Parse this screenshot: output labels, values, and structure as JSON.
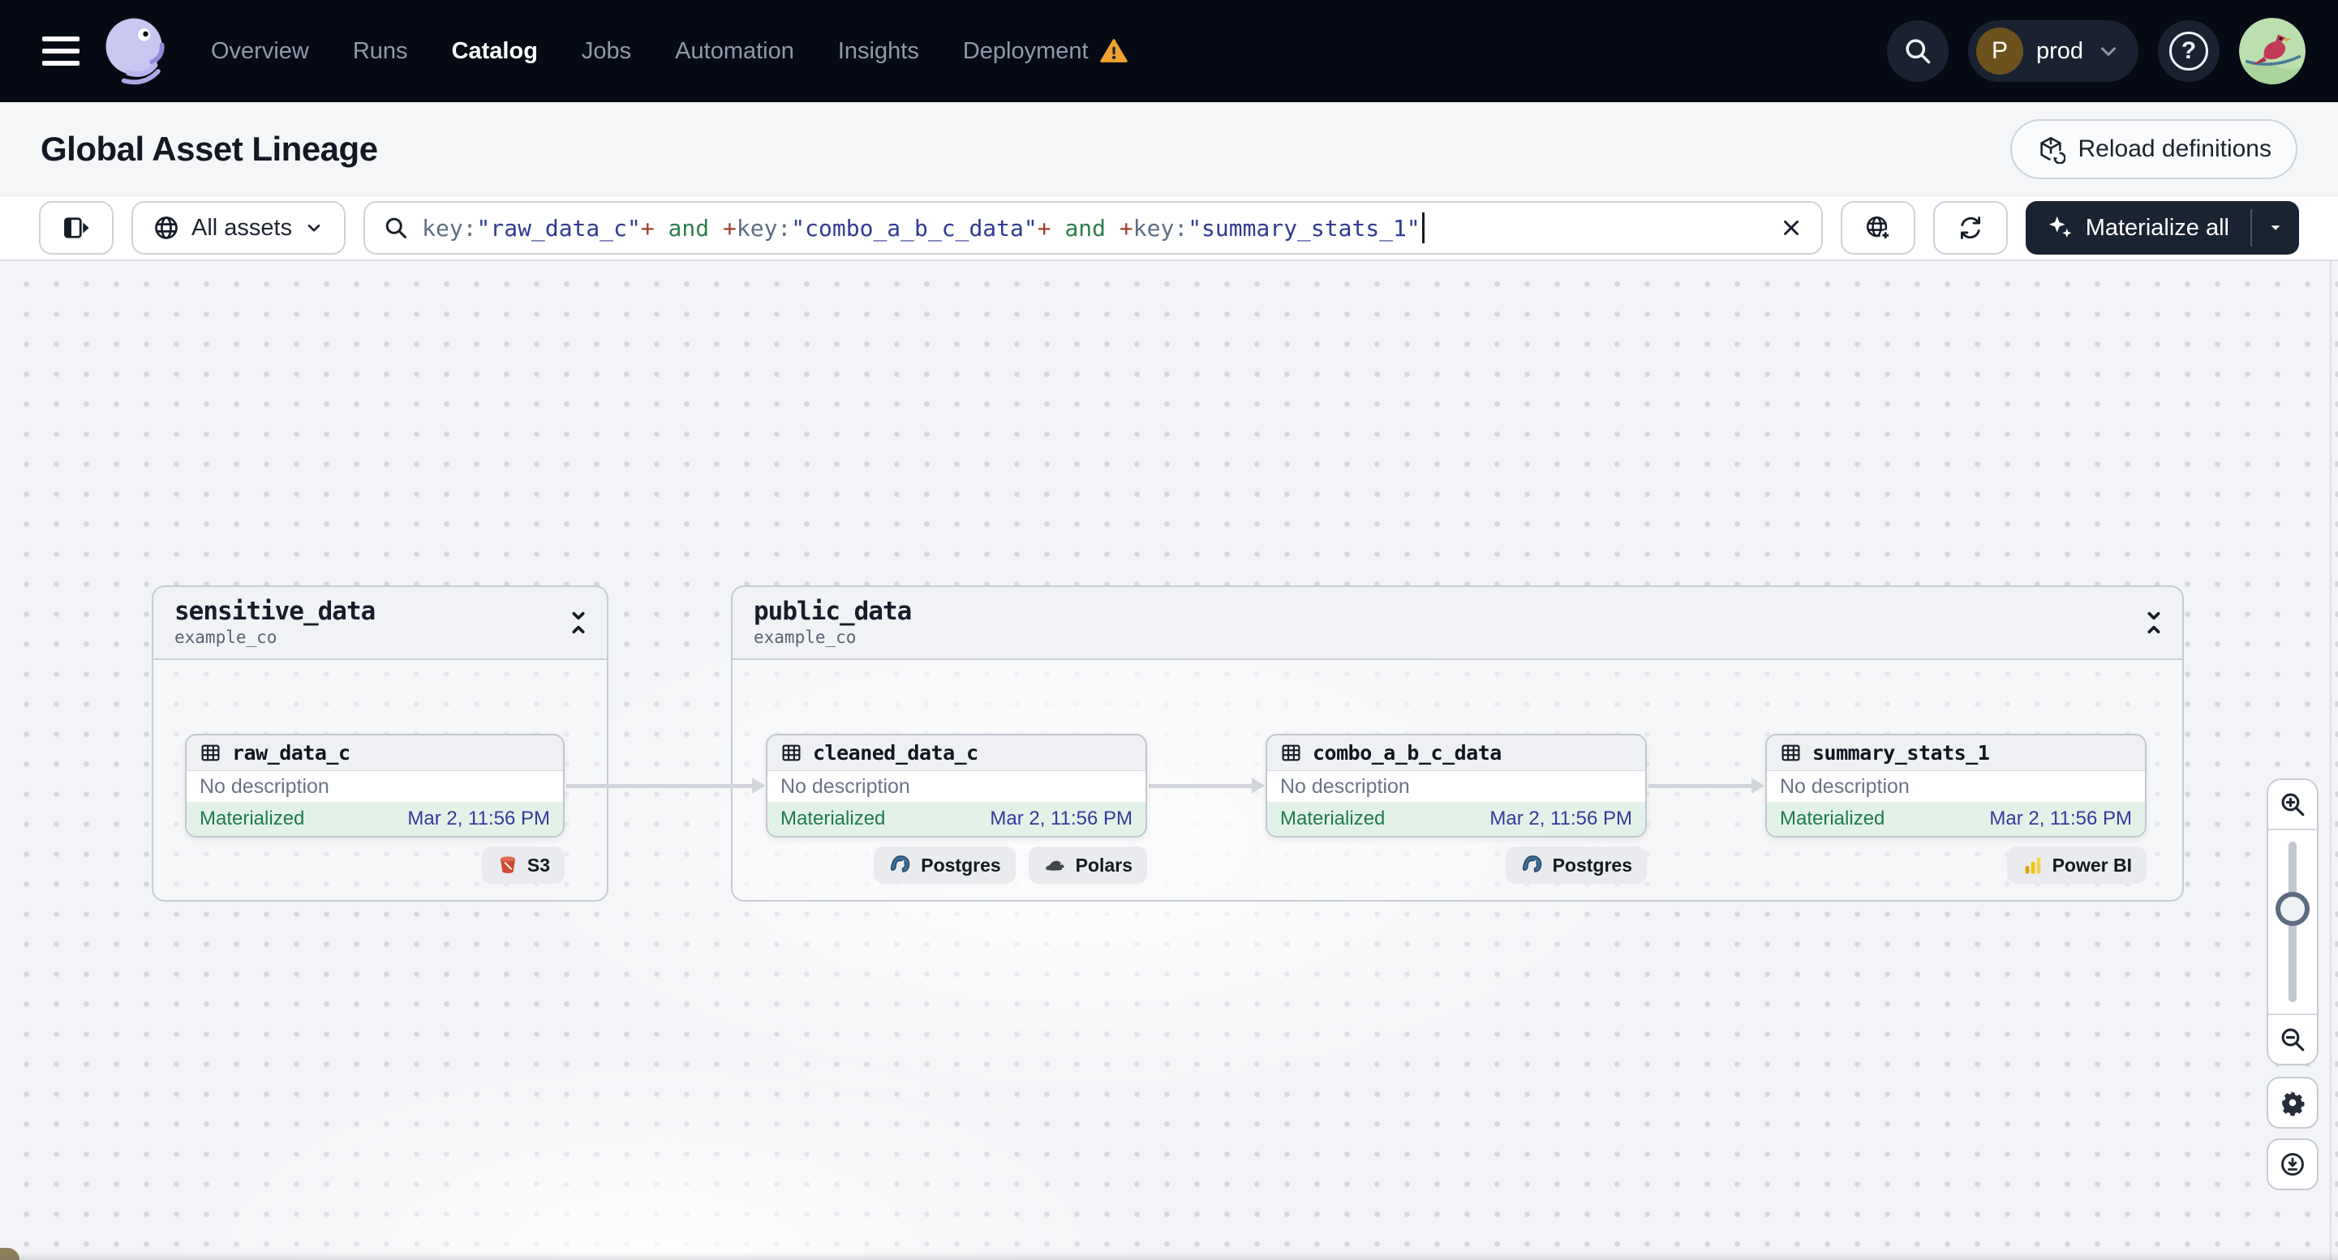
{
  "colors": {
    "nav_background": "#060a14",
    "accent_dark": "#1a2332",
    "warning_orange": "#f0a232",
    "status_green_text": "#1e7b4b",
    "status_green_bg": "#e3f2e9",
    "timestamp_indigo": "#343a9a",
    "query_key": "#5e6e82",
    "query_string": "#303a93",
    "query_plus": "#9e3e2a",
    "query_and": "#2f7d4c",
    "edge_gray": "#d2d5db"
  },
  "icons": {
    "nav": [
      "hamburger-icon",
      "dagster-logo",
      "warning-icon",
      "search-icon",
      "chevron-down-icon",
      "help-icon",
      "avatar"
    ],
    "toolbar": [
      "panel-toggle-icon",
      "globe-icon",
      "magnifier-icon",
      "clear-icon",
      "globe-plus-icon",
      "refresh-icon",
      "sparkle-icon",
      "caret-down-icon"
    ],
    "graph": [
      "table-icon",
      "collapse-icon",
      "s3-icon",
      "postgres-icon",
      "polars-icon",
      "powerbi-icon"
    ],
    "controls": [
      "zoom-in-icon",
      "zoom-out-icon",
      "gear-icon",
      "download-icon"
    ]
  },
  "nav": {
    "items": [
      {
        "label": "Overview"
      },
      {
        "label": "Runs"
      },
      {
        "label": "Catalog",
        "active": true
      },
      {
        "label": "Jobs"
      },
      {
        "label": "Automation"
      },
      {
        "label": "Insights"
      },
      {
        "label": "Deployment",
        "warning": true
      }
    ],
    "environment": {
      "initial": "P",
      "label": "prod"
    }
  },
  "header": {
    "title": "Global Asset Lineage",
    "reload_label": "Reload definitions"
  },
  "toolbar": {
    "assets_filter_label": "All assets",
    "query_segments": [
      {
        "text": "key:",
        "type": "key"
      },
      {
        "text": "\"raw_data_c\"",
        "type": "string"
      },
      {
        "text": "+",
        "type": "plus"
      },
      {
        "text": " and ",
        "type": "and"
      },
      {
        "text": "+",
        "type": "plus"
      },
      {
        "text": "key:",
        "type": "key"
      },
      {
        "text": "\"combo_a_b_c_data\"",
        "type": "string"
      },
      {
        "text": "+",
        "type": "plus"
      },
      {
        "text": " and ",
        "type": "and"
      },
      {
        "text": "+",
        "type": "plus"
      },
      {
        "text": "key:",
        "type": "key"
      },
      {
        "text": "\"summary_stats_1\"",
        "type": "string"
      }
    ],
    "materialize_label": "Materialize all"
  },
  "graph": {
    "groups": [
      {
        "name": "sensitive_data",
        "location": "example_co"
      },
      {
        "name": "public_data",
        "location": "example_co"
      }
    ],
    "nodes": [
      {
        "name": "raw_data_c",
        "description": "No description",
        "status": "Materialized",
        "materialized_at": "Mar 2, 11:56 PM",
        "tags": [
          {
            "label": "S3",
            "icon": "s3-icon"
          }
        ]
      },
      {
        "name": "cleaned_data_c",
        "description": "No description",
        "status": "Materialized",
        "materialized_at": "Mar 2, 11:56 PM",
        "tags": [
          {
            "label": "Postgres",
            "icon": "postgres-icon"
          },
          {
            "label": "Polars",
            "icon": "polars-icon"
          }
        ]
      },
      {
        "name": "combo_a_b_c_data",
        "description": "No description",
        "status": "Materialized",
        "materialized_at": "Mar 2, 11:56 PM",
        "tags": [
          {
            "label": "Postgres",
            "icon": "postgres-icon"
          }
        ]
      },
      {
        "name": "summary_stats_1",
        "description": "No description",
        "status": "Materialized",
        "materialized_at": "Mar 2, 11:56 PM",
        "tags": [
          {
            "label": "Power BI",
            "icon": "powerbi-icon"
          }
        ]
      }
    ]
  }
}
